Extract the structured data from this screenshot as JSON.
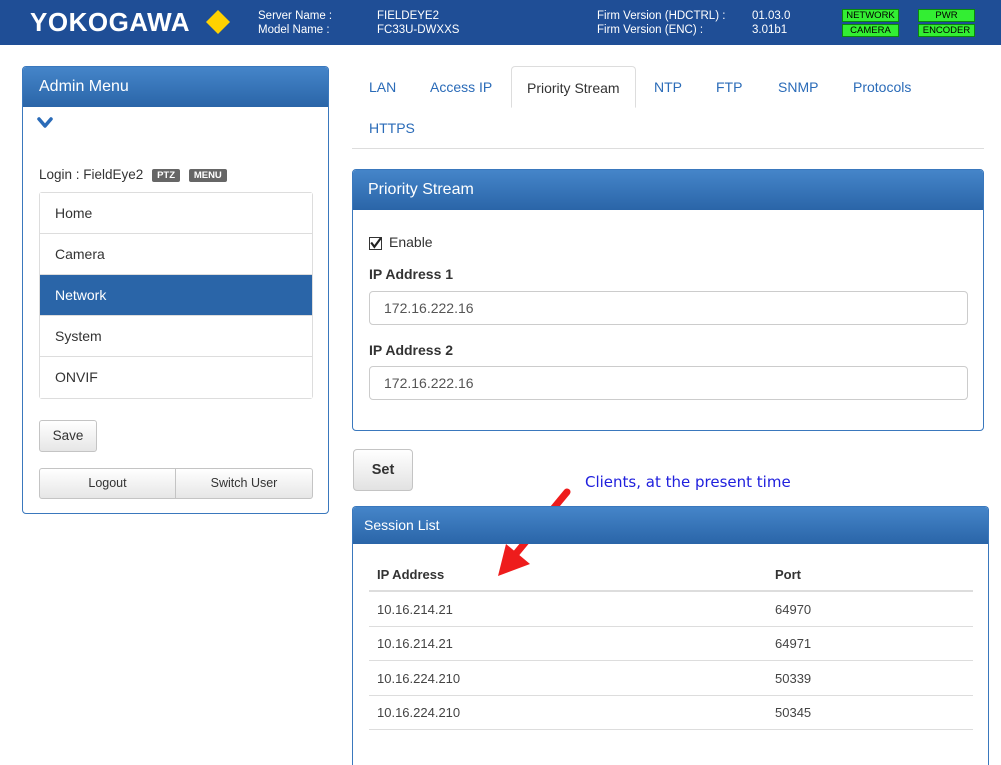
{
  "header": {
    "logo_text": "YOKOGAWA",
    "server_name_label": "Server Name :",
    "server_name_value": "FIELDEYE2",
    "model_name_label": "Model Name :",
    "model_name_value": "FC33U-DWXXS",
    "firm_hdctrl_label": "Firm Version (HDCTRL) :",
    "firm_hdctrl_value": "01.03.0",
    "firm_enc_label": "Firm Version (ENC) :",
    "firm_enc_value": "3.01b1",
    "status_indicators": [
      "NETWORK",
      "PWR",
      "CAMERA",
      "ENCODER"
    ],
    "status_color": "#33ee33",
    "brand_color": "#1f4e96"
  },
  "admin": {
    "title": "Admin Menu",
    "login_text": "Login : FieldEye2",
    "badges": [
      "PTZ",
      "MENU"
    ],
    "menu": [
      "Home",
      "Camera",
      "Network",
      "System",
      "ONVIF"
    ],
    "active_menu": "Network",
    "save_label": "Save",
    "logout_label": "Logout",
    "switch_user_label": "Switch User"
  },
  "tabs": [
    "LAN",
    "Access IP",
    "Priority Stream",
    "NTP",
    "FTP",
    "SNMP",
    "Protocols",
    "HTTPS"
  ],
  "active_tab": "Priority Stream",
  "priority_stream": {
    "title": "Priority Stream",
    "enable_label": "Enable",
    "enabled": true,
    "ip1_label": "IP Address 1",
    "ip1_value": "172.16.222.16",
    "ip2_label": "IP Address 2",
    "ip2_value": "172.16.222.16"
  },
  "set_label": "Set",
  "annotation": "Clients, at the present time",
  "session_list": {
    "title": "Session List",
    "col_ip": "IP Address",
    "col_port": "Port",
    "rows": [
      {
        "ip": "10.16.214.21",
        "port": "64970"
      },
      {
        "ip": "10.16.214.21",
        "port": "64971"
      },
      {
        "ip": "10.16.224.210",
        "port": "50339"
      },
      {
        "ip": "10.16.224.210",
        "port": "50345"
      }
    ]
  }
}
